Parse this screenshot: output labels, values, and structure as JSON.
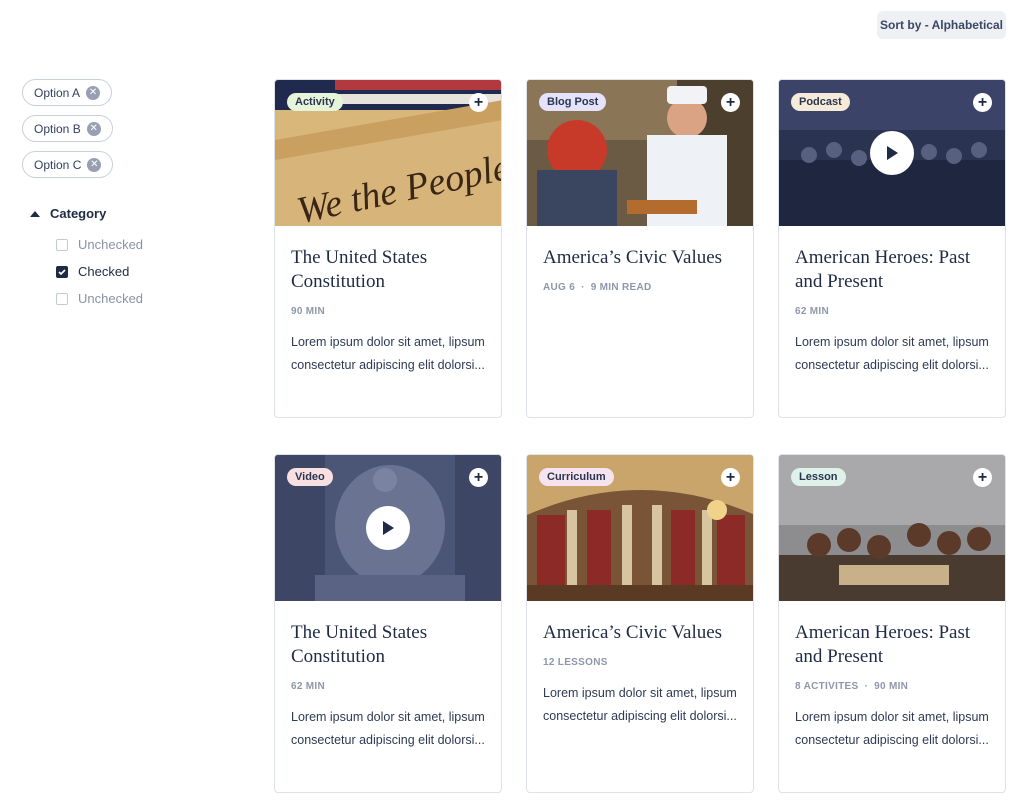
{
  "sort": {
    "label": "Sort by - Alphabetical"
  },
  "filters": {
    "chips": [
      "Option A",
      "Option B",
      "Option C"
    ],
    "category": {
      "label": "Category",
      "options": [
        {
          "label": "Unchecked",
          "checked": false
        },
        {
          "label": "Checked",
          "checked": true
        },
        {
          "label": "Unchecked",
          "checked": false
        }
      ]
    }
  },
  "cards": [
    {
      "badge": "Activity",
      "badge_color": "#e6f4d9",
      "title": "The United States Constitution",
      "meta": [
        "90 MIN"
      ],
      "desc": "Lorem ipsum dolor sit amet, lipsum consectetur adipiscing elit dolorsi...",
      "image": "constitution-flag",
      "play": false
    },
    {
      "badge": "Blog Post",
      "badge_color": "#e5e2fb",
      "title": "America’s Civic Values",
      "meta": [
        "AUG 6",
        "9 MIN READ"
      ],
      "desc": "",
      "image": "chef-serving",
      "play": false
    },
    {
      "badge": "Podcast",
      "badge_color": "#f6ead8",
      "title": "American Heroes: Past and Present",
      "meta": [
        "62 MIN"
      ],
      "desc": "Lorem ipsum dolor sit amet, lipsum consectetur adipiscing elit dolorsi...",
      "image": "painting-dark",
      "play": true
    },
    {
      "badge": "Video",
      "badge_color": "#f8dfe1",
      "title": "The United States Constitution",
      "meta": [
        "62 MIN"
      ],
      "desc": "Lorem ipsum dolor sit amet, lipsum consectetur adipiscing elit dolorsi...",
      "image": "statue",
      "play": true
    },
    {
      "badge": "Curriculum",
      "badge_color": "#f5e3f0",
      "title": "America’s Civic Values",
      "meta": [
        "12 LESSONS"
      ],
      "desc": "Lorem ipsum dolor sit amet, lipsum consectetur adipiscing elit dolorsi...",
      "image": "rotunda",
      "play": false
    },
    {
      "badge": "Lesson",
      "badge_color": "#def2ea",
      "title": "American Heroes: Past and Present",
      "meta": [
        "8 ACTIVITES",
        "90 MIN"
      ],
      "desc": "Lorem ipsum dolor sit amet, lipsum consectetur adipiscing elit dolorsi...",
      "image": "signing-painting",
      "play": false
    }
  ],
  "icons": {
    "chip_remove": "close-circle-icon",
    "card_add": "plus-icon",
    "play": "play-icon",
    "collapse": "triangle-up-icon",
    "check": "check-icon"
  }
}
